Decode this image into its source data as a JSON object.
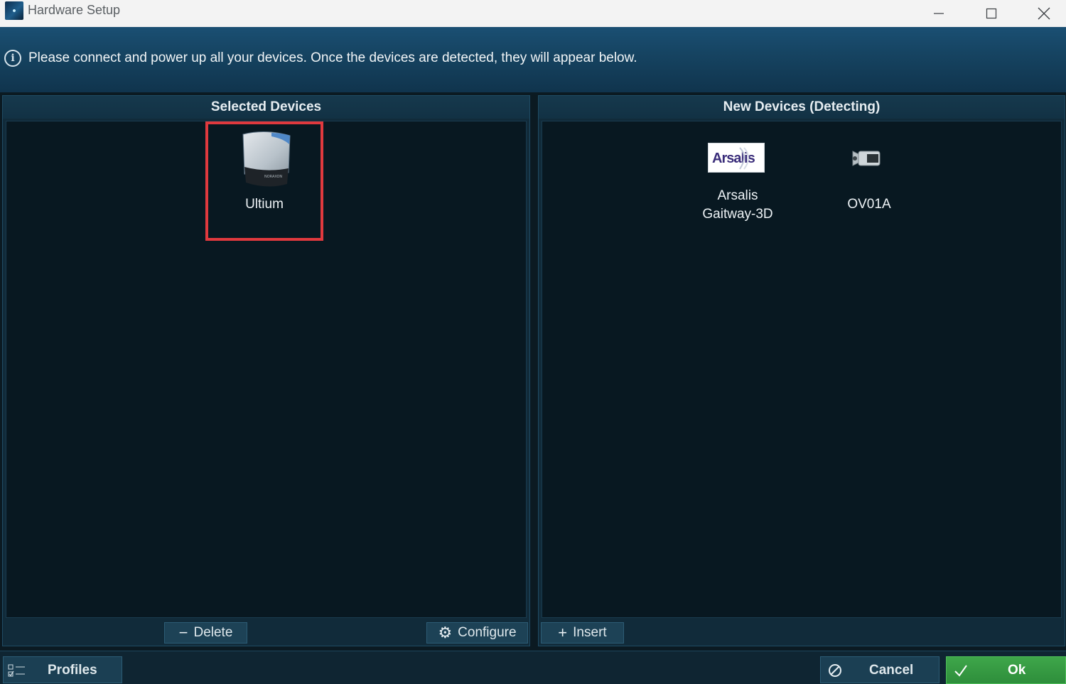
{
  "window": {
    "title": "Hardware Setup",
    "controls": [
      "minimize-icon",
      "maximize-icon",
      "close-icon"
    ]
  },
  "info": {
    "icon": "info-icon",
    "text": "Please connect and power up all your devices. Once the devices are detected, they will appear below."
  },
  "selected_panel": {
    "title": "Selected Devices",
    "devices": [
      {
        "label": "Ultium",
        "icon": "ultium-device-icon",
        "selected": true
      }
    ],
    "buttons": {
      "delete": {
        "symbol": "−",
        "label": "Delete"
      },
      "configure": {
        "symbol": "⚙",
        "label": "Configure"
      }
    }
  },
  "new_panel": {
    "title": "New Devices (Detecting)",
    "devices": [
      {
        "label_line1": "Arsalis",
        "label_line2": "Gaitway-3D",
        "icon": "arsalis-logo-icon",
        "logo_text": "Arsalis"
      },
      {
        "label": "OV01A",
        "icon": "video-camera-icon"
      }
    ],
    "buttons": {
      "insert": {
        "symbol": "+",
        "label": "Insert"
      }
    }
  },
  "footer": {
    "profiles": {
      "label": "Profiles",
      "icon": "profiles-checklist-icon"
    },
    "cancel": {
      "label": "Cancel",
      "icon": "cancel-icon"
    },
    "ok": {
      "label": "Ok",
      "icon": "checkmark-icon"
    }
  },
  "colors": {
    "highlight": "#e0393e",
    "ok_green": "#3ea64a",
    "panel_bg": "#081821",
    "band_blue": "#164462"
  }
}
